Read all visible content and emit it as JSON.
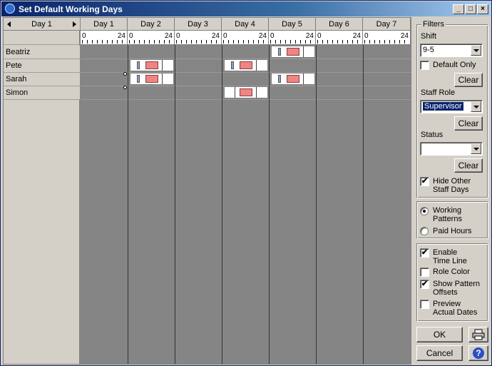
{
  "window": {
    "title": "Set Default Working Days"
  },
  "grid": {
    "nav_label": "Day 1",
    "days": [
      "Day 1",
      "Day 2",
      "Day 3",
      "Day 4",
      "Day 5",
      "Day 6",
      "Day 7"
    ],
    "ruler_start": "0",
    "ruler_end": "24",
    "staff": [
      "Beatriz",
      "Pete",
      "Sarah",
      "Simon"
    ]
  },
  "filters": {
    "group_title": "Filters",
    "shift_label": "Shift",
    "shift_value": "9-5",
    "default_only_label": "Default Only",
    "default_only_checked": false,
    "clear_label": "Clear",
    "staff_role_label": "Staff Role",
    "staff_role_value": "Supervisor",
    "status_label": "Status",
    "status_value": "",
    "hide_other_label": "Hide Other Staff Days",
    "hide_other_checked": true
  },
  "view": {
    "working_patterns_label": "Working Patterns",
    "paid_hours_label": "Paid Hours",
    "selected": "working_patterns"
  },
  "options": {
    "enable_timeline_label": "Enable Time Line",
    "enable_timeline_checked": true,
    "role_color_label": "Role Color",
    "role_color_checked": false,
    "show_offsets_label": "Show Pattern Offsets",
    "show_offsets_checked": true,
    "preview_dates_label": "Preview Actual Dates",
    "preview_dates_checked": false
  },
  "actions": {
    "ok_label": "OK",
    "cancel_label": "Cancel"
  },
  "icons": {
    "print": "printer-icon",
    "help": "help-icon"
  }
}
